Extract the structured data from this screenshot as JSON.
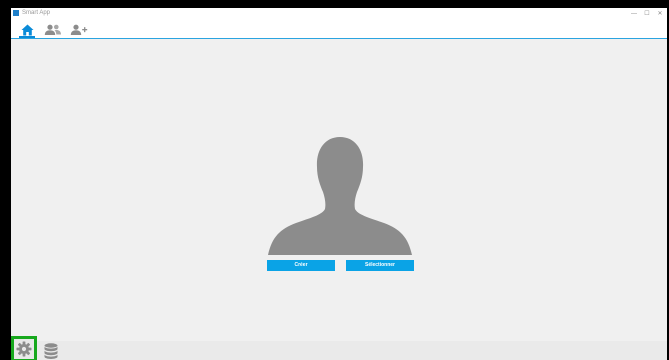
{
  "window": {
    "title": "Smart App",
    "controls": {
      "minimize": "—",
      "maximize": "☐",
      "close": "✕"
    }
  },
  "nav": {
    "tabs": [
      {
        "icon": "home-icon",
        "active": true
      },
      {
        "icon": "users-icon",
        "active": false
      },
      {
        "icon": "add-user-icon",
        "active": false
      }
    ]
  },
  "main": {
    "avatar_icon": "person-silhouette-icon",
    "create_label": "Créer",
    "select_label": "Sélectionner"
  },
  "bottom": {
    "settings_icon": "gear-icon",
    "database_icon": "database-icon"
  },
  "colors": {
    "accent": "#0aa3e6",
    "nav_active": "#0a8bd8",
    "highlight": "#17a81d",
    "background": "#f0f0f0"
  }
}
